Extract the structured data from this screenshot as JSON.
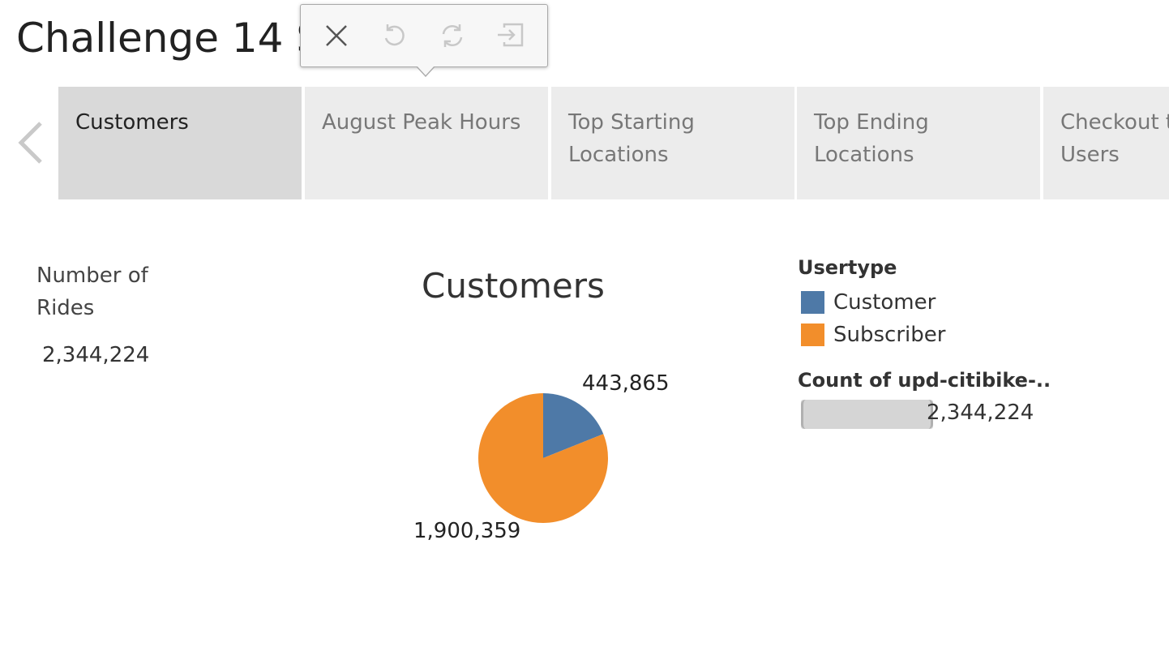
{
  "dashboard": {
    "title": "Challenge 14 S"
  },
  "toolbar": {
    "close_icon": "close-icon",
    "undo_icon": "undo-icon",
    "redo_icon": "refresh-icon",
    "exit_icon": "exit-icon"
  },
  "tabs": [
    {
      "label": "Customers",
      "active": true
    },
    {
      "label": "August Peak Hours",
      "active": false
    },
    {
      "label": "Top Starting\nLocations",
      "active": false
    },
    {
      "label": "Top Ending\nLocations",
      "active": false
    },
    {
      "label": "Checkout t\nUsers",
      "active": false
    }
  ],
  "kpi": {
    "label": "Number of\nRides",
    "value": "2,344,224"
  },
  "legend": {
    "title": "Usertype",
    "items": [
      {
        "label": "Customer",
        "color": "#4e79a7"
      },
      {
        "label": "Subscriber",
        "color": "#f28e2b"
      }
    ],
    "size_title": "Count of upd-citibike-..",
    "size_value": "2,344,224"
  },
  "chart_data": {
    "type": "pie",
    "title": "Customers",
    "categories": [
      "Customer",
      "Subscriber"
    ],
    "values": [
      443865,
      1900359
    ],
    "labels": [
      "443,865",
      "1,900,359"
    ],
    "colors": [
      "#4e79a7",
      "#f28e2b"
    ],
    "total": 2344224
  }
}
